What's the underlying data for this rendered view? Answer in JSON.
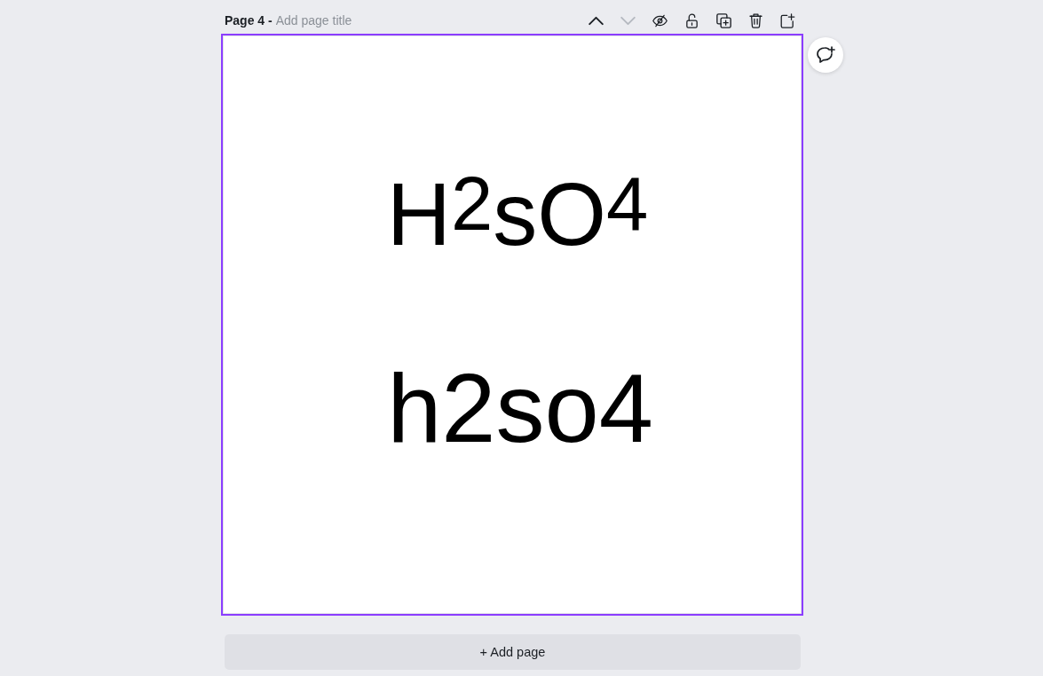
{
  "header": {
    "label": "Page 4 -",
    "title_field": {
      "placeholder": "Add page title"
    }
  },
  "toolbar": [
    {
      "kind": "move-up",
      "disabled": false
    },
    {
      "kind": "move-down",
      "disabled": true
    },
    {
      "kind": "hide",
      "disabled": false
    },
    {
      "kind": "lock",
      "disabled": false
    },
    {
      "kind": "duplicate",
      "disabled": false
    },
    {
      "kind": "delete",
      "disabled": false
    },
    {
      "kind": "add",
      "disabled": false
    }
  ],
  "page": {
    "selected": true,
    "texts": [
      "H$^{2}$sO$^{4}$",
      "h2so4"
    ]
  },
  "add_page_button": {
    "label": "+ Add page"
  }
}
